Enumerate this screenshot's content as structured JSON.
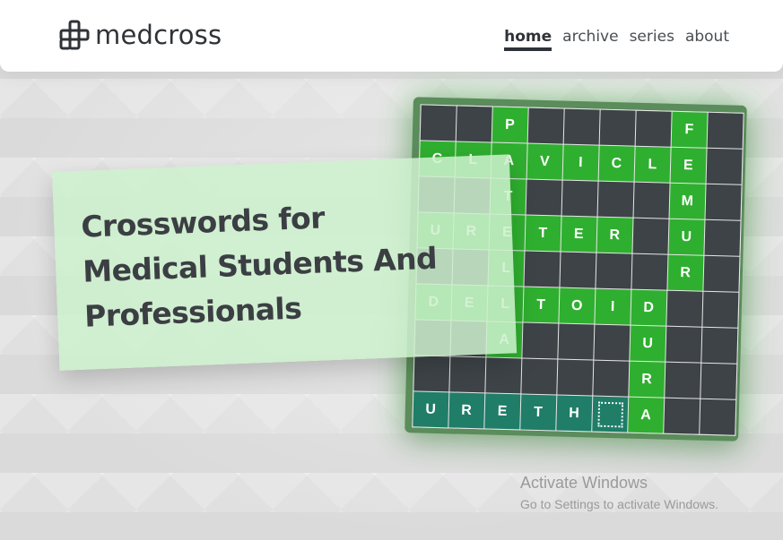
{
  "brand": {
    "name": "medcross",
    "logo_icon": "grid-cross-logo"
  },
  "nav": {
    "items": [
      {
        "label": "home",
        "active": true
      },
      {
        "label": "archive",
        "active": false
      },
      {
        "label": "series",
        "active": false
      },
      {
        "label": "about",
        "active": false
      }
    ]
  },
  "hero": {
    "title_lines": [
      "Crosswords for",
      "Medical Students And",
      "Professionals"
    ]
  },
  "crossword": {
    "cells": [
      [
        "",
        "",
        "P",
        "",
        "",
        "",
        "",
        "F",
        ""
      ],
      [
        "C",
        "L",
        "A",
        "V",
        "I",
        "C",
        "L",
        "E",
        ""
      ],
      [
        "",
        "",
        "T",
        "",
        "",
        "",
        "",
        "M",
        ""
      ],
      [
        "U",
        "R",
        "E",
        "T",
        "E",
        "R",
        "",
        "U",
        ""
      ],
      [
        "",
        "",
        "L",
        "",
        "",
        "",
        "",
        "R",
        ""
      ],
      [
        "D",
        "E",
        "L",
        "T",
        "O",
        "I",
        "D",
        "",
        ""
      ],
      [
        "",
        "",
        "A",
        "",
        "",
        "",
        "U",
        "",
        ""
      ],
      [
        "",
        "",
        "",
        "",
        "",
        "",
        "R",
        "",
        ""
      ],
      [
        "U",
        "R",
        "E",
        "T",
        "H",
        "",
        "A",
        "",
        ""
      ]
    ],
    "fill": [
      [
        "d",
        "d",
        "g",
        "d",
        "d",
        "d",
        "d",
        "g",
        "d"
      ],
      [
        "g",
        "g",
        "g",
        "g",
        "g",
        "g",
        "g",
        "g",
        "d"
      ],
      [
        "d",
        "d",
        "g",
        "d",
        "d",
        "d",
        "d",
        "g",
        "d"
      ],
      [
        "g",
        "g",
        "g",
        "g",
        "g",
        "g",
        "d",
        "g",
        "d"
      ],
      [
        "d",
        "d",
        "g",
        "d",
        "d",
        "d",
        "d",
        "g",
        "d"
      ],
      [
        "g",
        "g",
        "g",
        "g",
        "g",
        "g",
        "g",
        "d",
        "d"
      ],
      [
        "d",
        "d",
        "g",
        "d",
        "d",
        "d",
        "g",
        "d",
        "d"
      ],
      [
        "d",
        "d",
        "d",
        "d",
        "d",
        "d",
        "g",
        "d",
        "d"
      ],
      [
        "t",
        "t",
        "t",
        "t",
        "t",
        "s",
        "g",
        "d",
        "d"
      ]
    ],
    "colors": {
      "dark": "#3d4347",
      "green": "#2faf2f",
      "teal": "#1f7d68",
      "frame": "#5b8c5b"
    }
  },
  "watermark": {
    "title": "Activate Windows",
    "subtitle": "Go to Settings to activate Windows."
  }
}
